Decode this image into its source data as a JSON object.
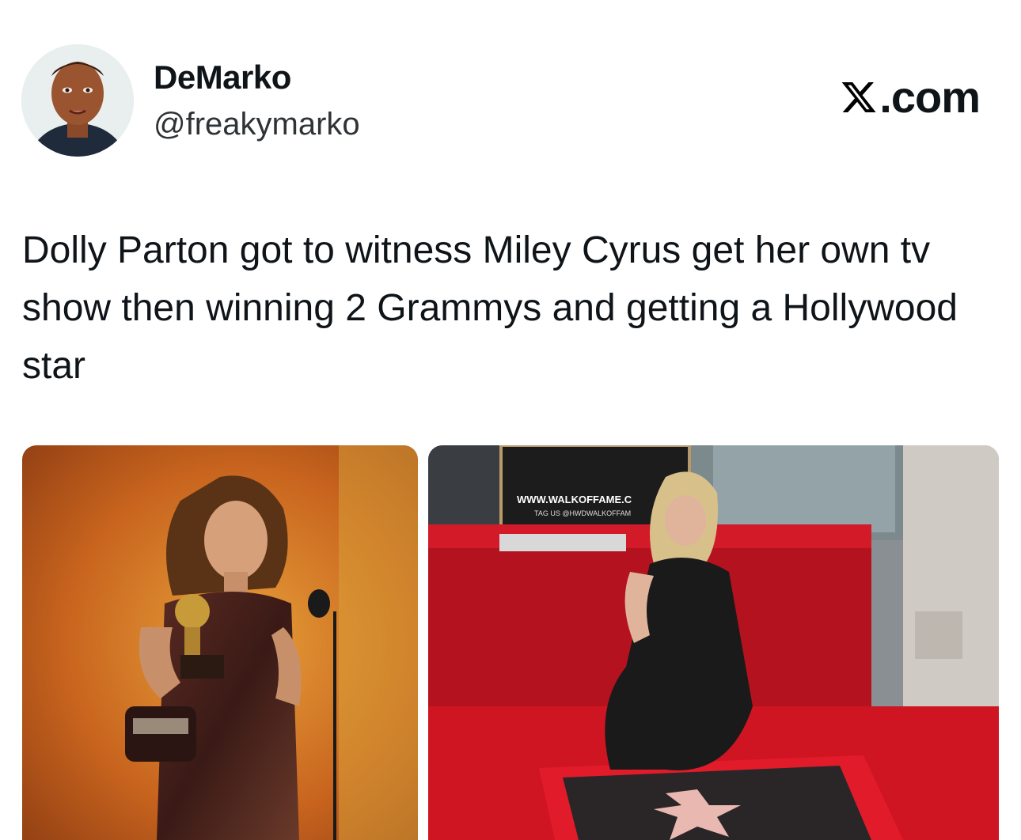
{
  "author": {
    "display_name": "DeMarko",
    "handle": "@freakymarko",
    "avatar_icon": "profile-photo"
  },
  "brand": {
    "logo_icon": "x-logo-icon",
    "domain_suffix": ".com"
  },
  "tweet": {
    "text": "Dolly Parton got to witness Miley Cyrus get her own tv show then winning 2 Grammys and getting a Hollywood star"
  },
  "media": {
    "left_photo": {
      "description_icon": "grammy-photo"
    },
    "right_photo": {
      "description_icon": "walk-of-fame-photo",
      "sign_url": "WWW.WALKOFFAME.C",
      "sign_tag": "TAG US @HWDWALKOFFAM"
    }
  },
  "colors": {
    "text_primary": "#0f1419",
    "text_secondary": "#2f3336",
    "carpet_red": "#c8101e"
  }
}
